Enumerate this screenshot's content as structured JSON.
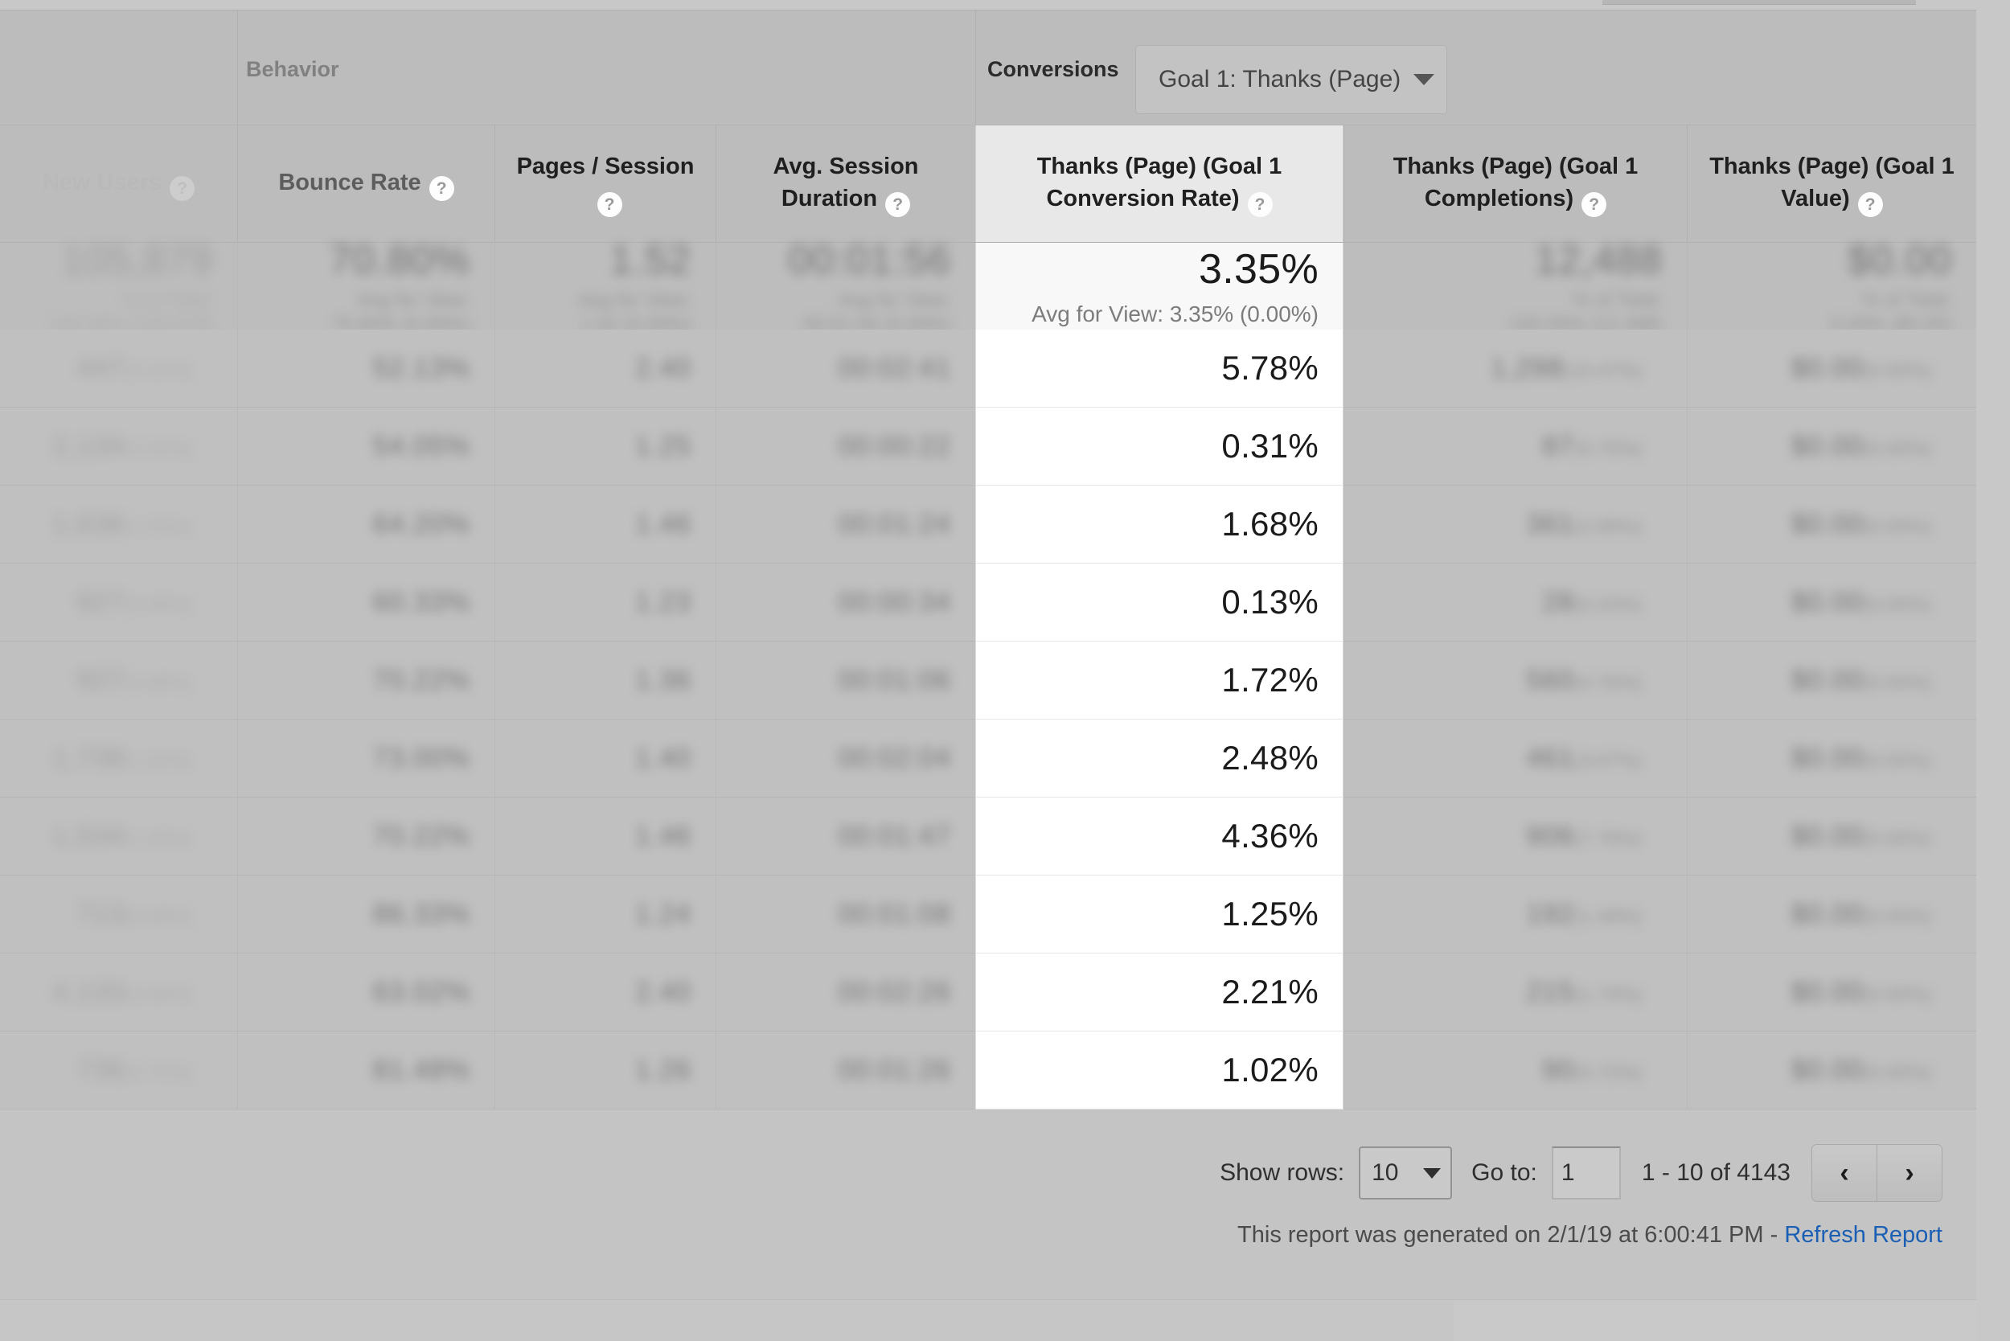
{
  "groups": {
    "behavior_label": "Behavior",
    "conversions_label": "Conversions",
    "goal_selector": {
      "value": "Goal 1: Thanks (Page)",
      "caret_icon": "chevron-down-icon"
    }
  },
  "columns": [
    {
      "label": "New Users",
      "help": "?",
      "faded": true
    },
    {
      "label": "Bounce Rate",
      "help": "?",
      "faded": false
    },
    {
      "label": "Pages / Session",
      "help": "?",
      "faded": false
    },
    {
      "label": "Avg. Session Duration",
      "help": "?",
      "faded": false
    },
    {
      "label": "Thanks (Page) (Goal 1 Conversion Rate)",
      "help": "?",
      "faded": false
    },
    {
      "label": "Thanks (Page) (Goal 1 Completions)",
      "help": "?",
      "faded": false
    },
    {
      "label": "Thanks (Page) (Goal 1 Value)",
      "help": "?",
      "faded": false
    }
  ],
  "summary_row": {
    "new_users": {
      "main": "105,879",
      "sub1": "% of Total:",
      "sub2": "100.00% (105,879)"
    },
    "bounce_rate": {
      "main": "70.80%",
      "sub1": "Avg for View:",
      "sub2": "70.80% (0.00%)"
    },
    "pages_session": {
      "main": "1.52",
      "sub1": "Avg for View:",
      "sub2": "1.52 (0.00%)"
    },
    "avg_duration": {
      "main": "00:01:56",
      "sub1": "Avg for View:",
      "sub2": "00:01:56 (0.00%)"
    },
    "conversion_rate": {
      "main": "3.35%",
      "sub": "Avg for View: 3.35% (0.00%)"
    },
    "completions": {
      "main": "12,488",
      "sub1": "% of Total:",
      "sub2": "100.00% (12,488)"
    },
    "value": {
      "main": "$0.00",
      "sub1": "% of Total:",
      "sub2": "0.00% ($0.00)"
    }
  },
  "rows": [
    {
      "new_users": "447",
      "new_users_pct": "(0.42%)",
      "bounce_rate": "52.13%",
      "pages_session": "2.40",
      "avg_duration": "00:02:41",
      "conversion_rate": "5.78%",
      "completions": "1,298",
      "completions_pct": "(10.47%)",
      "value": "$0.00",
      "value_pct": "(0.00%)"
    },
    {
      "new_users": "2,134",
      "new_users_pct": "(2.02%)",
      "bounce_rate": "54.05%",
      "pages_session": "1.25",
      "avg_duration": "00:00:22",
      "conversion_rate": "0.31%",
      "completions": "87",
      "completions_pct": "(0.70%)",
      "value": "$0.00",
      "value_pct": "(0.00%)"
    },
    {
      "new_users": "1,636",
      "new_users_pct": "(1.55%)",
      "bounce_rate": "64.20%",
      "pages_session": "1.46",
      "avg_duration": "00:01:24",
      "conversion_rate": "1.68%",
      "completions": "361",
      "completions_pct": "(2.89%)",
      "value": "$0.00",
      "value_pct": "(0.00%)"
    },
    {
      "new_users": "927",
      "new_users_pct": "(0.88%)",
      "bounce_rate": "60.33%",
      "pages_session": "1.23",
      "avg_duration": "00:00:34",
      "conversion_rate": "0.13%",
      "completions": "28",
      "completions_pct": "(0.22%)",
      "value": "$0.00",
      "value_pct": "(0.00%)"
    },
    {
      "new_users": "927",
      "new_users_pct": "(0.88%)",
      "bounce_rate": "70.22%",
      "pages_session": "1.36",
      "avg_duration": "00:01:06",
      "conversion_rate": "1.72%",
      "completions": "560",
      "completions_pct": "(4.76%)",
      "value": "$0.00",
      "value_pct": "(0.00%)"
    },
    {
      "new_users": "1,738",
      "new_users_pct": "(1.64%)",
      "bounce_rate": "73.00%",
      "pages_session": "1.40",
      "avg_duration": "00:02:04",
      "conversion_rate": "2.48%",
      "completions": "461",
      "completions_pct": "(3.67%)",
      "value": "$0.00",
      "value_pct": "(0.00%)"
    },
    {
      "new_users": "1,534",
      "new_users_pct": "(1.45%)",
      "bounce_rate": "70.22%",
      "pages_session": "1.46",
      "avg_duration": "00:01:47",
      "conversion_rate": "4.36%",
      "completions": "906",
      "completions_pct": "(7.76%)",
      "value": "$0.00",
      "value_pct": "(0.00%)"
    },
    {
      "new_users": "713",
      "new_users_pct": "(0.68%)",
      "bounce_rate": "86.33%",
      "pages_session": "1.24",
      "avg_duration": "00:01:08",
      "conversion_rate": "1.25%",
      "completions": "192",
      "completions_pct": "(1.49%)",
      "value": "$0.00",
      "value_pct": "(0.00%)"
    },
    {
      "new_users": "4,133",
      "new_users_pct": "(3.90%)",
      "bounce_rate": "63.02%",
      "pages_session": "2.40",
      "avg_duration": "00:02:26",
      "conversion_rate": "2.21%",
      "completions": "215",
      "completions_pct": "(1.73%)",
      "value": "$0.00",
      "value_pct": "(0.00%)"
    },
    {
      "new_users": "736",
      "new_users_pct": "(0.70%)",
      "bounce_rate": "81.48%",
      "pages_session": "1.26",
      "avg_duration": "00:01:26",
      "conversion_rate": "1.02%",
      "completions": "90",
      "completions_pct": "(0.72%)",
      "value": "$0.00",
      "value_pct": "(0.00%)"
    }
  ],
  "pager": {
    "show_rows_label": "Show rows:",
    "rows_value": "10",
    "rows_caret_icon": "chevron-down-icon",
    "goto_label": "Go to:",
    "goto_value": "1",
    "range_text": "1 - 10 of 4143",
    "prev_icon": "‹",
    "next_icon": "›"
  },
  "report_footer": {
    "text": "This report was generated on 2/1/19 at 6:00:41 PM - ",
    "link_label": "Refresh Report"
  },
  "colors": {
    "page_background": "#c4c4c4",
    "header_background": "#bcbcbc",
    "highlight_column": "#ffffff",
    "highlight_summary": "#f8f8f8",
    "link": "#1a5fb4"
  }
}
